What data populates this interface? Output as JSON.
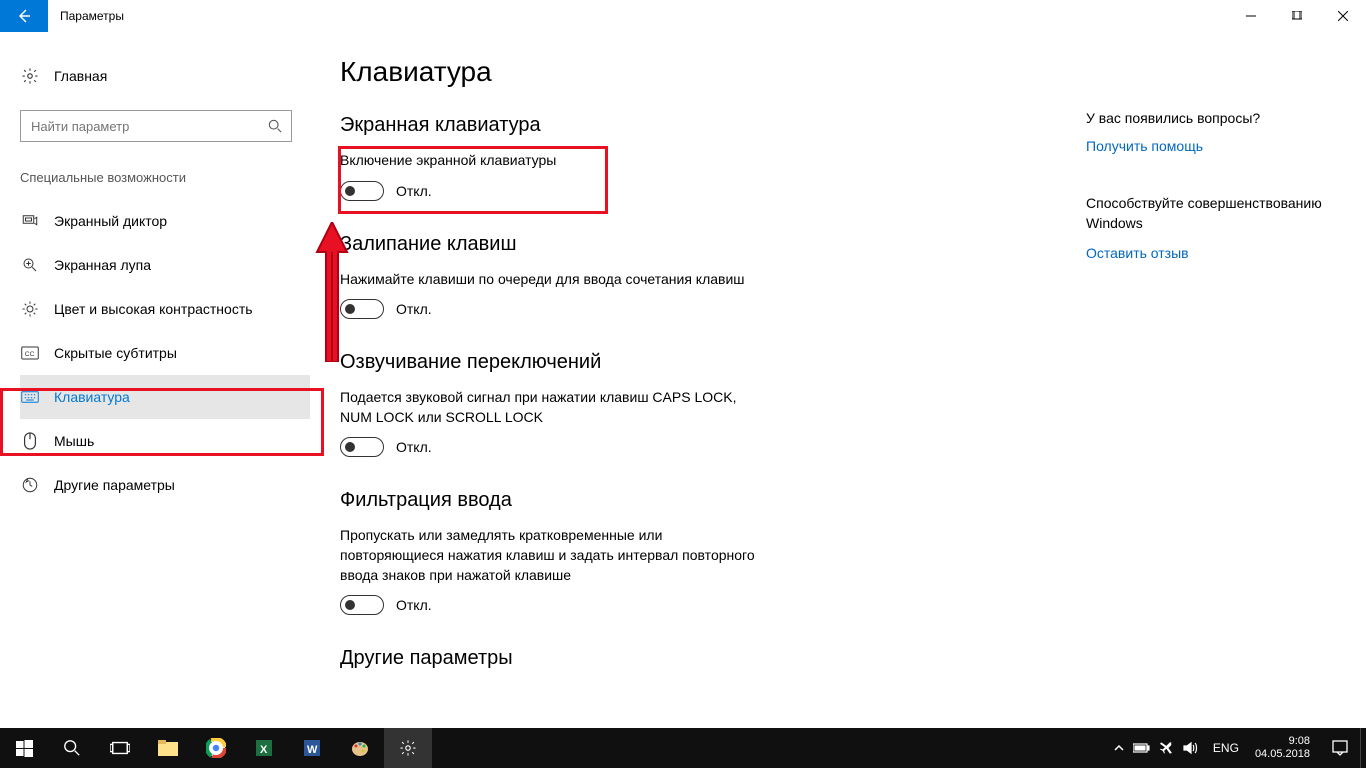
{
  "window": {
    "title": "Параметры"
  },
  "sidebar": {
    "home": "Главная",
    "search_placeholder": "Найти параметр",
    "category": "Специальные возможности",
    "items": [
      {
        "label": "Экранный диктор"
      },
      {
        "label": "Экранная лупа"
      },
      {
        "label": "Цвет и высокая контрастность"
      },
      {
        "label": "Скрытые субтитры"
      },
      {
        "label": "Клавиатура"
      },
      {
        "label": "Мышь"
      },
      {
        "label": "Другие параметры"
      }
    ]
  },
  "main": {
    "title": "Клавиатура",
    "sections": [
      {
        "heading": "Экранная клавиатура",
        "desc": "Включение экранной клавиатуры",
        "state": "Откл."
      },
      {
        "heading": "Залипание клавиш",
        "desc": "Нажимайте клавиши по очереди для ввода сочетания клавиш",
        "state": "Откл."
      },
      {
        "heading": "Озвучивание переключений",
        "desc": "Подается звуковой сигнал при нажатии клавиш CAPS LOCK, NUM LOCK или SCROLL LOCK",
        "state": "Откл."
      },
      {
        "heading": "Фильтрация ввода",
        "desc": "Пропускать или замедлять кратковременные или повторяющиеся нажатия клавиш и задать интервал повторного ввода знаков при нажатой клавише",
        "state": "Откл."
      },
      {
        "heading": "Другие параметры",
        "desc": "",
        "state": ""
      }
    ]
  },
  "right": {
    "question": "У вас появились вопросы?",
    "help_link": "Получить помощь",
    "improve_msg": "Способствуйте совершенствованию Windows",
    "feedback_link": "Оставить отзыв"
  },
  "taskbar": {
    "lang": "ENG",
    "time": "9:08",
    "date": "04.05.2018"
  }
}
